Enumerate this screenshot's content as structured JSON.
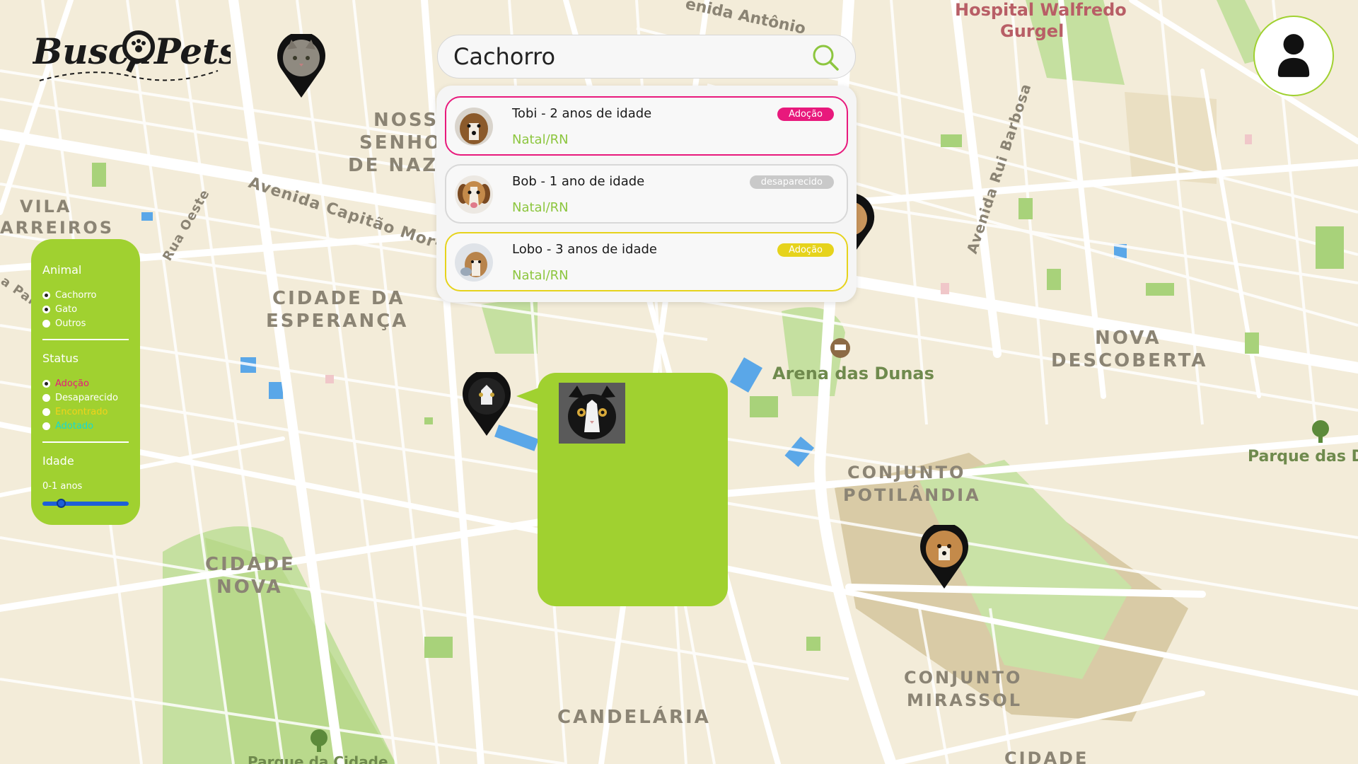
{
  "app": {
    "logo_left": "Busca",
    "logo_right": "Pets"
  },
  "search": {
    "value": "Cachorro",
    "icon": "search-icon"
  },
  "results": [
    {
      "name": "Tobi - 2 anos de idade",
      "city": "Natal/RN",
      "badge": "Adoção",
      "badge_color": "#e8197c",
      "border": "pink",
      "animal": "dog"
    },
    {
      "name": "Bob - 1 ano de idade",
      "city": "Natal/RN",
      "badge": "desaparecido",
      "badge_color": "#c9c9c9",
      "border": "gray",
      "animal": "dog"
    },
    {
      "name": "Lobo - 3 anos de idade",
      "city": "Natal/RN",
      "badge": "Adoção",
      "badge_color": "#e6d31c",
      "border": "yellow",
      "animal": "dog"
    }
  ],
  "filters": {
    "animal_title": "Animal",
    "animal_options": [
      {
        "label": "Cachorro",
        "selected": true,
        "color": "#ffffff"
      },
      {
        "label": "Gato",
        "selected": true,
        "color": "#ffffff"
      },
      {
        "label": "Outros",
        "selected": false,
        "color": "#ffffff"
      }
    ],
    "status_title": "Status",
    "status_options": [
      {
        "label": "Adoção",
        "selected": true,
        "color": "#e8197c"
      },
      {
        "label": "Desaparecido",
        "selected": false,
        "color": "#ffffff"
      },
      {
        "label": "Encontrado",
        "selected": false,
        "color": "#f2d21b"
      },
      {
        "label": "Adotado",
        "selected": false,
        "color": "#17d9d0"
      }
    ],
    "age_title": "Idade",
    "age_value": "0-1 anos",
    "age_slider_fraction": 0.18
  },
  "map_labels": {
    "hospital_1": "Hospital Walfredo",
    "hospital_2": "Gurgel",
    "avenida_antonio": "enida Antônio",
    "nossa_1": "NOSSA",
    "nossa_2": "SENHO",
    "nossa_3": "DE NAZA",
    "vila_1": "VILA",
    "vila_2": "ARREIROS",
    "capitao": "Avenida Capitão Mor-Go",
    "rua_oeste": "Rua Oeste",
    "rui_barbosa": "Avenida Rui Barbosa",
    "esperanca_1": "CIDADE DA",
    "esperanca_2": "ESPERANÇA",
    "nova_desc_1": "NOVA",
    "nova_desc_2": "DESCOBERTA",
    "arena": "Arena das Dunas",
    "parque_dunas": "Parque das Du",
    "potilandia_1": "CONJUNTO",
    "potilandia_2": "POTILÂNDIA",
    "cidade_nova_1": "CIDADE",
    "cidade_nova_2": "NOVA",
    "candelaria": "CANDELÁRIA",
    "mirassol_1": "CONJUNTO",
    "mirassol_2": "MIRASSOL",
    "cidade_bottom": "CIDADE",
    "parque_cidade": "Parque da Cidade",
    "pal": "a Pal"
  },
  "colors": {
    "accent": "#a0d130",
    "map_bg": "#f3ecd9",
    "road": "#ffffff",
    "park": "#c5e0a0",
    "water": "#5aa7e8"
  }
}
